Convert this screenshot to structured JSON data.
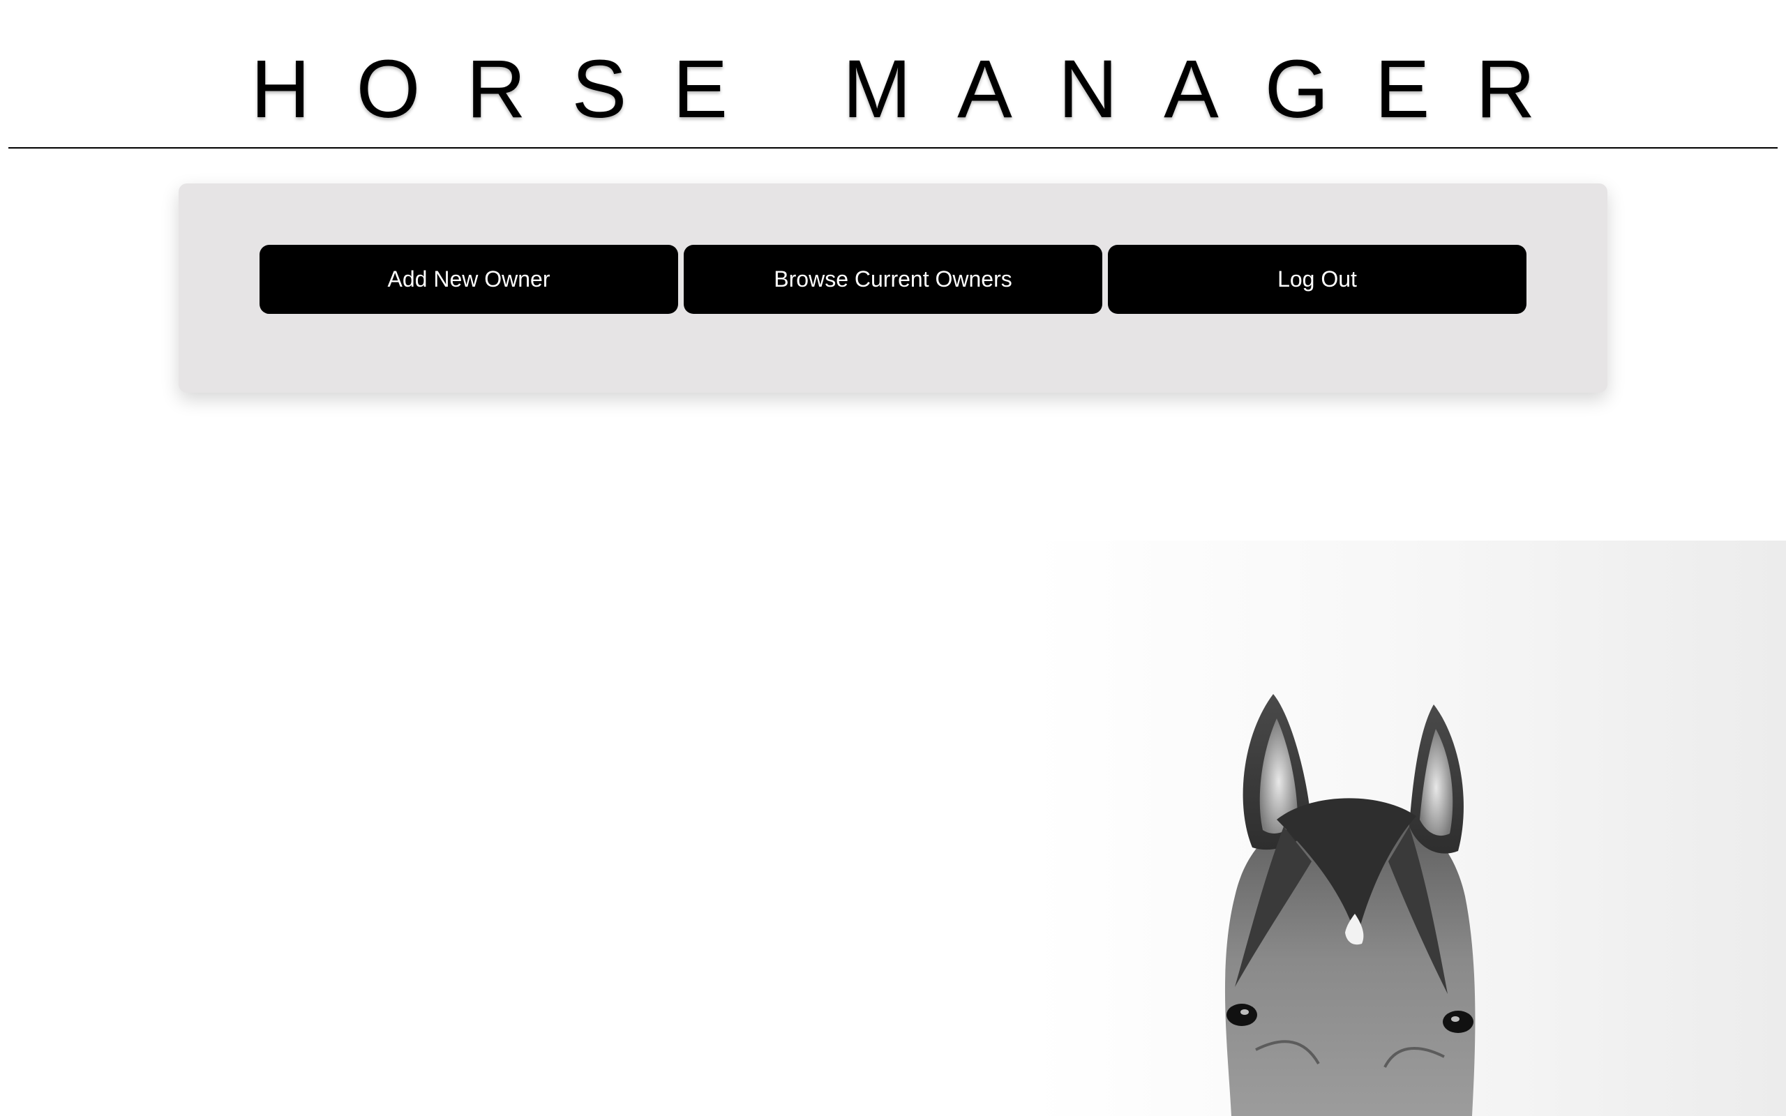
{
  "header": {
    "title": "HORSE MANAGER"
  },
  "nav": {
    "add_owner_label": "Add New Owner",
    "browse_owners_label": "Browse Current Owners",
    "logout_label": "Log Out"
  },
  "colors": {
    "button_bg": "#000000",
    "button_text": "#ffffff",
    "panel_bg": "#e6e4e5",
    "page_bg": "#ffffff"
  },
  "hero": {
    "image_icon": "horse-head-photo"
  }
}
